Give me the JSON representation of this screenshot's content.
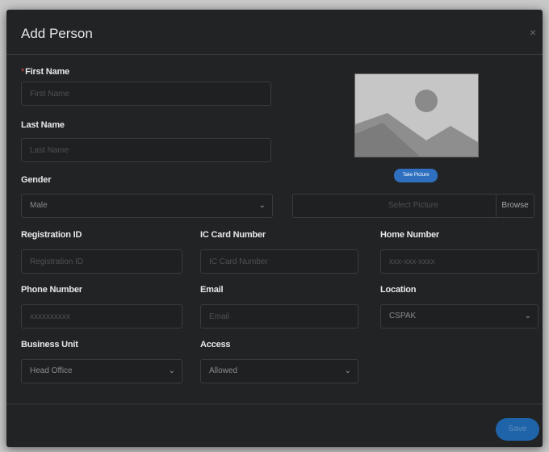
{
  "dialog": {
    "title": "Add Person",
    "close_glyph": "×"
  },
  "fields": {
    "first_name": {
      "label": "First Name",
      "required_mark": "*",
      "placeholder": "First Name"
    },
    "last_name": {
      "label": "Last Name",
      "placeholder": "Last Name"
    },
    "gender": {
      "label": "Gender",
      "selected": "Male"
    },
    "registration_id": {
      "label": "Registration ID",
      "placeholder": "Registration ID"
    },
    "ic_card_number": {
      "label": "IC Card Number",
      "placeholder": "IC Card Number"
    },
    "home_number": {
      "label": "Home Number",
      "placeholder": "xxx-xxx-xxxx"
    },
    "phone_number": {
      "label": "Phone Number",
      "placeholder": "xxxxxxxxxx"
    },
    "email": {
      "label": "Email",
      "placeholder": "Email"
    },
    "location": {
      "label": "Location",
      "selected": "CSPAK"
    },
    "business_unit": {
      "label": "Business Unit",
      "selected": "Head Office"
    },
    "access": {
      "label": "Access",
      "selected": "Allowed"
    }
  },
  "photo": {
    "icon": "image-placeholder-icon",
    "take_picture_label": "Take Picture",
    "file_placeholder": "Select Picture",
    "browse_label": "Browse"
  },
  "footer": {
    "save_label": "Save"
  },
  "icons": {
    "chevron": "chevron-down-icon",
    "close": "close-icon"
  },
  "colors": {
    "background": "#222325",
    "primary": "#2e6fbf",
    "text": "#e9e9e9"
  }
}
